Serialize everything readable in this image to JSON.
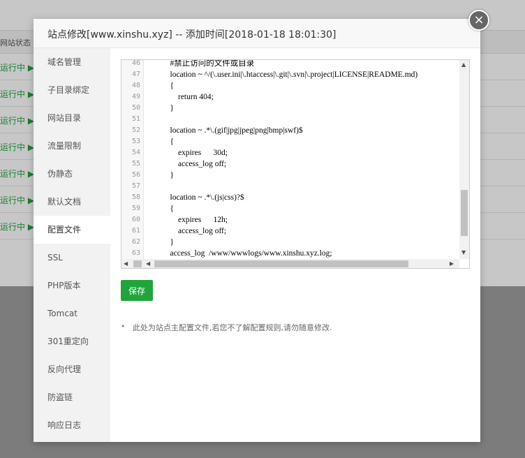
{
  "background": {
    "header_label": "网站状态",
    "row_status": [
      "运行中 ▶",
      "运行中 ▶",
      "运行中 ▶",
      "运行中 ▶",
      "运行中 ▶",
      "运行中 ▶",
      "运行中 ▶"
    ]
  },
  "modal": {
    "title": "站点修改[www.xinshu.xyz] -- 添加时间[2018-01-18 18:01:30]",
    "close_label": "×"
  },
  "sidebar": {
    "items": [
      {
        "label": "域名管理"
      },
      {
        "label": "子目录绑定"
      },
      {
        "label": "网站目录"
      },
      {
        "label": "流量限制"
      },
      {
        "label": "伪静态"
      },
      {
        "label": "默认文档"
      },
      {
        "label": "配置文件",
        "active": true
      },
      {
        "label": "SSL"
      },
      {
        "label": "PHP版本"
      },
      {
        "label": "Tomcat"
      },
      {
        "label": "301重定向"
      },
      {
        "label": "反向代理"
      },
      {
        "label": "防盗链"
      },
      {
        "label": "响应日志"
      }
    ]
  },
  "editor": {
    "lines": [
      {
        "no": "46",
        "text": "    #禁止访问的文件或目录"
      },
      {
        "no": "47",
        "text": "    location ~ ^/(\\.user.ini|\\.htaccess|\\.git|\\.svn|\\.project|LICENSE|README.md)"
      },
      {
        "no": "48",
        "text": "    {"
      },
      {
        "no": "49",
        "text": "        return 404;"
      },
      {
        "no": "50",
        "text": "    }"
      },
      {
        "no": "51",
        "text": ""
      },
      {
        "no": "52",
        "text": "    location ~ .*\\.(gif|jpg|jpeg|png|bmp|swf)$"
      },
      {
        "no": "53",
        "text": "    {"
      },
      {
        "no": "54",
        "text": "        expires      30d;"
      },
      {
        "no": "55",
        "text": "        access_log off;"
      },
      {
        "no": "56",
        "text": "    }"
      },
      {
        "no": "57",
        "text": ""
      },
      {
        "no": "58",
        "text": "    location ~ .*\\.(js|css)?$"
      },
      {
        "no": "59",
        "text": "    {"
      },
      {
        "no": "60",
        "text": "        expires      12h;"
      },
      {
        "no": "61",
        "text": "        access_log off;"
      },
      {
        "no": "62",
        "text": "    }"
      },
      {
        "no": "63",
        "text": "    access_log  /www/wwwlogs/www.xinshu.xyz.log;"
      }
    ]
  },
  "actions": {
    "save_label": "保存"
  },
  "note": {
    "bullet": "•",
    "text": "此处为站点主配置文件,若您不了解配置规则,请勿随意修改."
  },
  "colors": {
    "accent": "#20a53a",
    "status_green": "#20a53a"
  }
}
